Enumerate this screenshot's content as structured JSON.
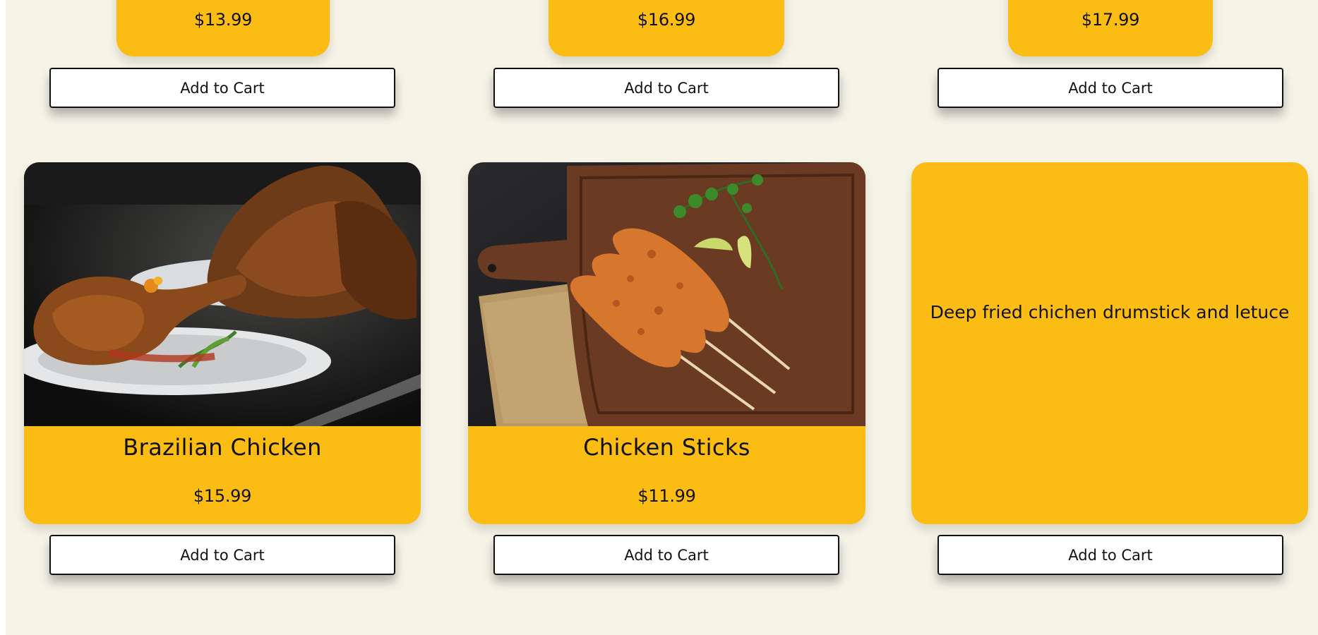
{
  "cart_label": "Add to Cart",
  "top_row": [
    {
      "price": "$13.99"
    },
    {
      "price": "$16.99"
    },
    {
      "price": "$17.99"
    }
  ],
  "bottom_row": [
    {
      "name": "Brazilian Chicken",
      "price": "$15.99",
      "image": "roast-chicken-plate"
    },
    {
      "name": "Chicken Sticks",
      "price": "$11.99",
      "image": "chicken-skewers-board"
    },
    {
      "description": "Deep fried chichen drumstick and letuce"
    }
  ],
  "colors": {
    "accent": "#fbbd13",
    "background": "#f6f3e7",
    "button_bg": "#ffffff",
    "text": "#111111"
  }
}
